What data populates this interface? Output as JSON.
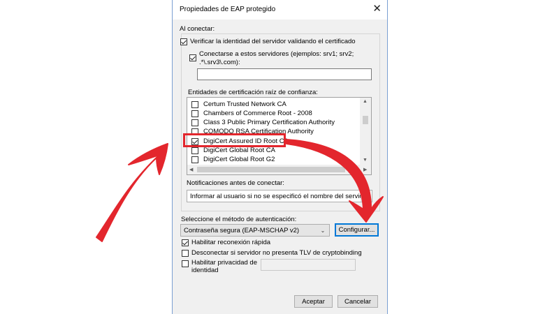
{
  "dialog": {
    "title": "Propiedades de EAP protegido",
    "close_glyph": "✕",
    "on_connect_label": "Al conectar:",
    "verify_identity_label": "Verificar la identidad del servidor validando el certificado",
    "connect_servers_label_line1": "Conectarse a estos servidores (ejemplos: srv1; srv2;",
    "connect_servers_label_line2": ".*\\.srv3\\.com):",
    "servers_value": "",
    "trusted_ca_label": "Entidades de certificación raíz de confianza:",
    "ca_list": [
      {
        "label": "Certum Trusted Network CA",
        "checked": false
      },
      {
        "label": "Chambers of Commerce Root - 2008",
        "checked": false
      },
      {
        "label": "Class 3 Public Primary Certification Authority",
        "checked": false
      },
      {
        "label": "COMODO RSA Certification Authority",
        "checked": false
      },
      {
        "label": "DigiCert Assured ID Root CA",
        "checked": true
      },
      {
        "label": "DigiCert Global Root CA",
        "checked": false
      },
      {
        "label": "DigiCert Global Root G2",
        "checked": false
      }
    ],
    "notifications_label": "Notificaciones antes de conectar:",
    "notifications_value": "Informar al usuario si no se especificó el nombre del servidor",
    "auth_method_label": "Seleccione el método de autenticación:",
    "auth_method_value": "Contraseña segura (EAP-MSCHAP v2)",
    "configure_button": "Configurar...",
    "fast_reconnect_label": "Habilitar reconexión rápida",
    "disconnect_tlv_label": "Desconectar si servidor no presenta TLV de cryptobinding",
    "privacy_label_line1": "Habilitar privacidad de",
    "privacy_label_line2": "identidad",
    "privacy_value": "",
    "accept_button": "Aceptar",
    "cancel_button": "Cancelar"
  },
  "colors": {
    "highlight_red": "#e3262d",
    "focus_blue": "#0078d7",
    "dialog_bg": "#f0f0f0"
  }
}
